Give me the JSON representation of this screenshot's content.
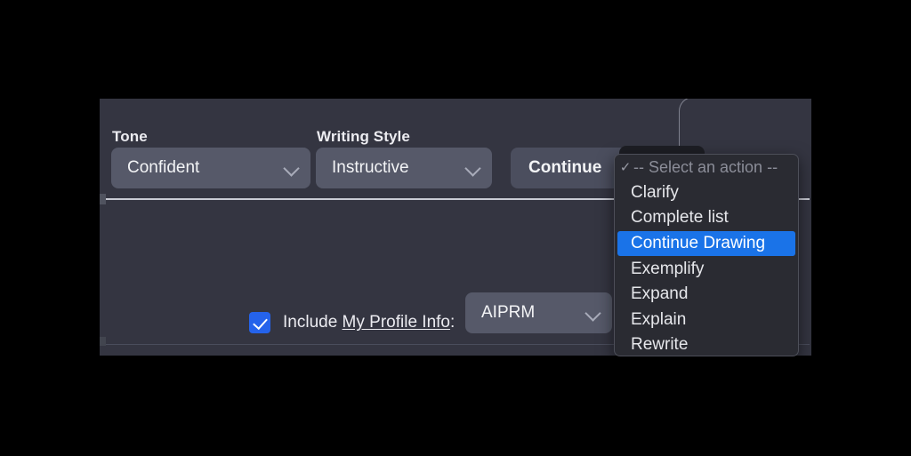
{
  "panel": {
    "fields": [
      {
        "label": "Tone",
        "value": "Confident",
        "icon": "chevron-down-icon"
      },
      {
        "label": "Writing Style",
        "value": "Instructive",
        "icon": "chevron-down-icon"
      }
    ],
    "continue_button": "Continue"
  },
  "profile_row": {
    "checkbox_checked": true,
    "text_prefix": "Include ",
    "link_text": "My Profile Info",
    "text_suffix": ":",
    "select_value": "AIPRM",
    "select_icon": "chevron-down-icon"
  },
  "action_dropdown": {
    "placeholder_check": "✓",
    "placeholder": "-- Select an action --",
    "selected": "Continue Drawing",
    "options": [
      "Clarify",
      "Complete list",
      "Continue Drawing",
      "Exemplify",
      "Expand",
      "Explain",
      "Rewrite"
    ]
  },
  "colors": {
    "panel_background": "#343541",
    "select_background": "#565969",
    "dropdown_background": "#2a2b32",
    "highlight": "#1a73e8",
    "checkbox": "#2563eb",
    "text": "#ececf1",
    "muted_text": "#8b8d98"
  }
}
